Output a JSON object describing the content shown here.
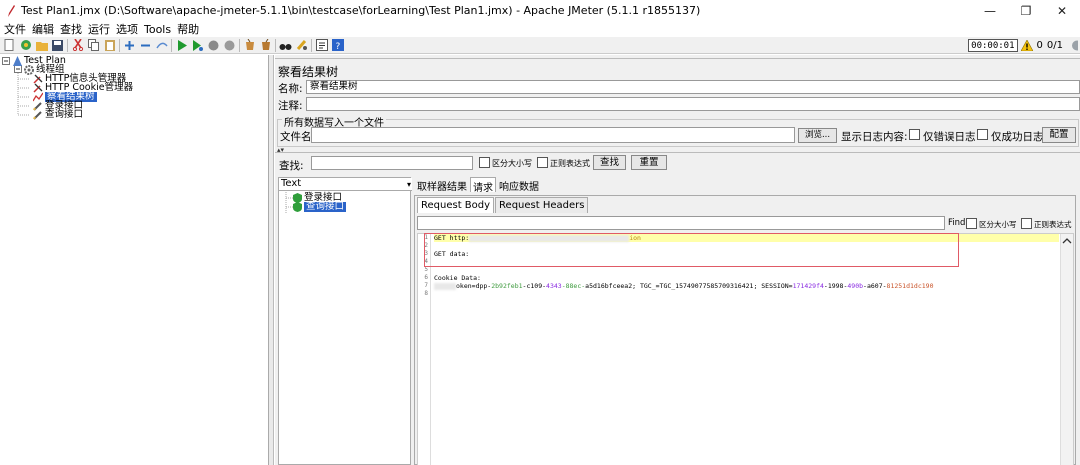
{
  "window": {
    "title": "Test Plan1.jmx (D:\\Software\\apache-jmeter-5.1.1\\bin\\testcase\\forLearning\\Test Plan1.jmx) - Apache JMeter (5.1.1 r1855137)",
    "minimize": "—",
    "maximize": "❐",
    "close": "✕"
  },
  "menu": [
    "文件",
    "编辑",
    "查找",
    "运行",
    "选项",
    "Tools",
    "帮助"
  ],
  "toolbar": {
    "timer": "00:00:01",
    "warning_count": "0",
    "threads": "0/1"
  },
  "tree": {
    "root": "Test Plan",
    "thread_group": "线程组",
    "header_manager": "HTTP信息头管理器",
    "cookie_manager": "HTTP Cookie管理器",
    "result_tree": "察看结果树",
    "login": "登录接口",
    "query": "查询接口"
  },
  "panel": {
    "title": "察看结果树",
    "name_label": "名称:",
    "name_value": "察看结果树",
    "comment_label": "注释:",
    "comment_value": "",
    "file_group_title": "所有数据写入一个文件",
    "filename_label": "文件名",
    "filename_value": "",
    "browse_button": "浏览...",
    "log_display_label": "显示日志内容:",
    "errors_only": "仅错误日志",
    "success_only": "仅成功日志",
    "configure_button": "配置",
    "search_label": "查找:",
    "search_value": "",
    "case_sensitive": "区分大小写",
    "regex": "正则表达式",
    "find_button": "查找",
    "reset_button": "重置"
  },
  "sampler_list": {
    "renderer": "Text",
    "items": [
      "登录接口",
      "查询接口"
    ],
    "selected_index": 1
  },
  "tabs": [
    "取样器结果",
    "请求",
    "响应数据"
  ],
  "active_tab": "请求",
  "subtabs": [
    "Request Body",
    "Request Headers"
  ],
  "active_subtab": "Request Body",
  "find_bar": {
    "label": "Find",
    "case_sensitive": "区分大小写",
    "regex": "正则表达式"
  },
  "request_body": {
    "line_numbers": [
      "1",
      "2",
      "3",
      "4",
      "5",
      "6",
      "7",
      "8"
    ],
    "line1_prefix": "GET http:",
    "line1_suffix": "ion",
    "line3": "GET data:",
    "line6": "Cookie Data:",
    "line7": {
      "token_prefix": "oken=dpp-",
      "token_a": "2b92feb1",
      "token_b": "-c109-",
      "token_c": "4343",
      "token_d": "-88ec-",
      "token_e": "a5d16bfceea2; TGC_=TGC_15749077585709316421; SESSION=",
      "sess_a": "171429f4",
      "sess_b": "-1998-",
      "sess_c": "490b",
      "sess_d": "-a607-",
      "sess_e": "81251d1dc190"
    }
  },
  "colors": {
    "selection": "#2a63c9",
    "highlight_line": "#ffffaa",
    "annotation_box": "#e05a66",
    "hex_green": "#3d9a3d",
    "hex_purple": "#8a2be2"
  }
}
